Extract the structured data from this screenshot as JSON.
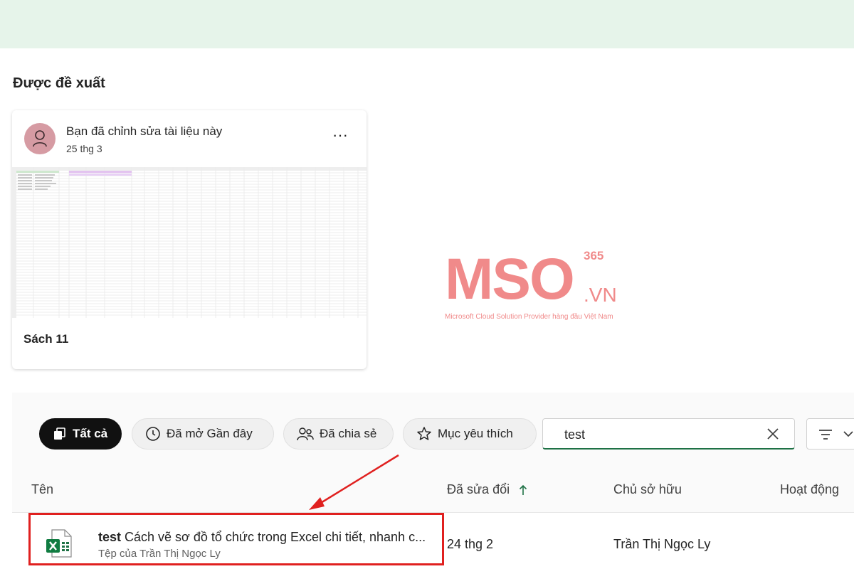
{
  "section_title": "Được đề xuất",
  "card": {
    "activity": "Bạn đã chỉnh sửa tài liệu này",
    "date": "25 thg 3",
    "more": "···",
    "name": "Sách 11"
  },
  "watermark": {
    "logo": "MSO",
    "superscript": "365",
    "domain": ".VN",
    "tagline": "Microsoft Cloud Solution Provider hàng đầu Việt Nam"
  },
  "filters": {
    "all": "Tất cả",
    "recent": "Đã mở Gần đây",
    "shared": "Đã chia sẻ",
    "favorites": "Mục yêu thích"
  },
  "search": {
    "value": "test"
  },
  "columns": {
    "name": "Tên",
    "modified": "Đã sửa đổi",
    "owner": "Chủ sở hữu",
    "activity": "Hoạt động"
  },
  "file": {
    "match": "test",
    "title": " Cách vẽ sơ đồ tổ chức trong Excel chi tiết, nhanh c...",
    "owner_line": "Tệp của Trần Thị Ngọc Ly",
    "date": "24 thg 2",
    "owner": "Trần Thị Ngọc Ly"
  },
  "colors": {
    "accent_green": "#1e7145",
    "annotation_red": "#e0201f",
    "topbar": "#e6f4ea",
    "watermark": "#f08a8a"
  }
}
